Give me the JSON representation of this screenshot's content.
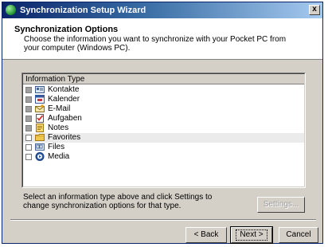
{
  "window": {
    "title": "Synchronization Setup Wizard",
    "close_label": "x"
  },
  "header": {
    "title": "Synchronization Options",
    "subtitle": "Choose the information you want to synchronize with your Pocket PC from your computer (Windows PC)."
  },
  "list": {
    "column_header": "Information Type",
    "items": [
      {
        "label": "Kontakte",
        "checked": true,
        "icon": "contacts-icon"
      },
      {
        "label": "Kalender",
        "checked": true,
        "icon": "calendar-icon"
      },
      {
        "label": "E-Mail",
        "checked": true,
        "icon": "email-icon"
      },
      {
        "label": "Aufgaben",
        "checked": true,
        "icon": "tasks-icon"
      },
      {
        "label": "Notes",
        "checked": true,
        "icon": "notes-icon"
      },
      {
        "label": "Favorites",
        "checked": false,
        "icon": "favorites-folder-icon",
        "selected": true
      },
      {
        "label": "Files",
        "checked": false,
        "icon": "files-icon"
      },
      {
        "label": "Media",
        "checked": false,
        "icon": "media-icon"
      }
    ]
  },
  "hint": "Select an information type above and click Settings to change synchronization options for that type.",
  "buttons": {
    "settings": "Settings...",
    "back": "< Back",
    "next": "Next >",
    "cancel": "Cancel"
  }
}
